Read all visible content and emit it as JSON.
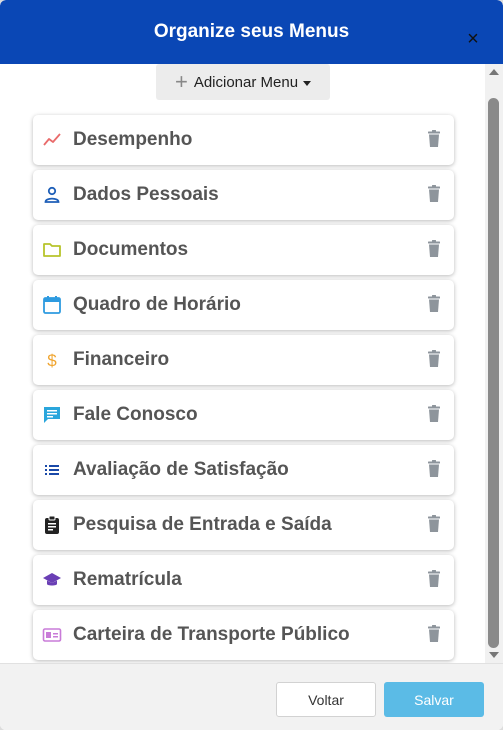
{
  "modal": {
    "title": "Organize seus Menus",
    "close_symbol": "×"
  },
  "toolbar": {
    "add_menu_label": "Adicionar Menu",
    "add_menu_icon": "plus-icon"
  },
  "menu_items": [
    {
      "label": "Desempenho",
      "icon": "chart-line-icon",
      "color": "#e96b6b"
    },
    {
      "label": "Dados Pessoais",
      "icon": "person-icon",
      "color": "#1e5fb8"
    },
    {
      "label": "Documentos",
      "icon": "folder-icon",
      "color": "#b7c42b"
    },
    {
      "label": "Quadro de Horário",
      "icon": "calendar-icon",
      "color": "#2e9be0"
    },
    {
      "label": "Financeiro",
      "icon": "dollar-icon",
      "color": "#f0a530"
    },
    {
      "label": "Fale Conosco",
      "icon": "chat-icon",
      "color": "#2aa6dc"
    },
    {
      "label": "Avaliação de Satisfação",
      "icon": "list-icon",
      "color": "#1a49a8"
    },
    {
      "label": "Pesquisa de Entrada e Saída",
      "icon": "clipboard-icon",
      "color": "#222222"
    },
    {
      "label": "Rematrícula",
      "icon": "graduation-cap-icon",
      "color": "#6a3fb5"
    },
    {
      "label": "Carteira de Transporte Público",
      "icon": "id-card-icon",
      "color": "#c97bd8"
    }
  ],
  "trash_icon_color": "#8e959c",
  "footer": {
    "cancel_label": "Voltar",
    "save_label": "Salvar"
  },
  "colors": {
    "header": "#0a47b5",
    "save_button": "#5bbbe6"
  }
}
